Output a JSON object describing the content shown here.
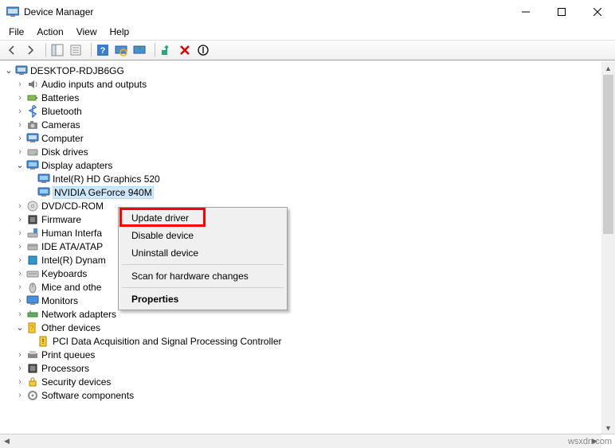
{
  "window": {
    "title": "Device Manager"
  },
  "menu": {
    "file": "File",
    "action": "Action",
    "view": "View",
    "help": "Help"
  },
  "tree": {
    "root": "DESKTOP-RDJB6GG",
    "audio": "Audio inputs and outputs",
    "batteries": "Batteries",
    "bluetooth": "Bluetooth",
    "cameras": "Cameras",
    "computer": "Computer",
    "disk": "Disk drives",
    "display": "Display adapters",
    "display_intel": "Intel(R) HD Graphics 520",
    "display_nvidia": "NVIDIA GeForce 940M",
    "dvd": "DVD/CD-ROM",
    "firmware": "Firmware",
    "hid": "Human Interfa",
    "ide": "IDE ATA/ATAP",
    "dynam": "Intel(R) Dynam",
    "keyboards": "Keyboards",
    "mice": "Mice and othe",
    "monitors": "Monitors",
    "network": "Network adapters",
    "other": "Other devices",
    "pci": "PCI Data Acquisition and Signal Processing Controller",
    "printq": "Print queues",
    "processors": "Processors",
    "security": "Security devices",
    "software": "Software components"
  },
  "context": {
    "update": "Update driver",
    "disable": "Disable device",
    "uninstall": "Uninstall device",
    "scan": "Scan for hardware changes",
    "properties": "Properties"
  },
  "watermark": "wsxdn.com"
}
